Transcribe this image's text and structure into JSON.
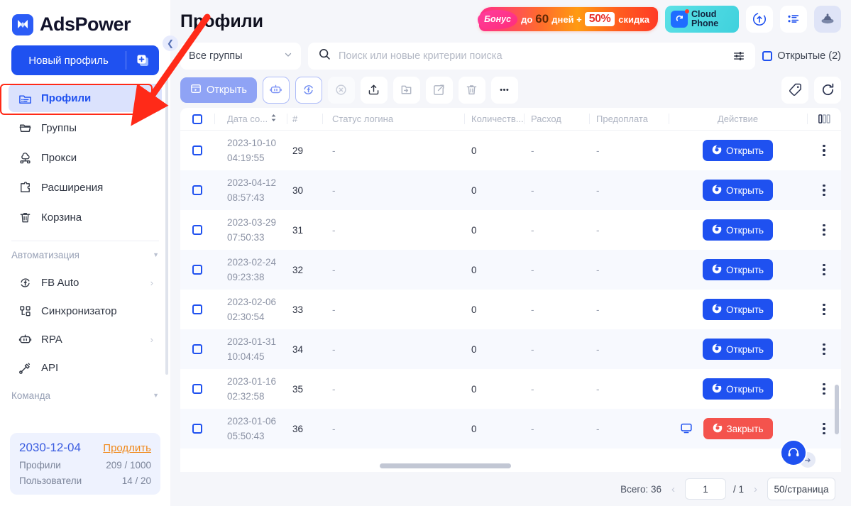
{
  "brand": {
    "name": "AdsPower"
  },
  "sidebar": {
    "new_profile_label": "Новый профиль",
    "items": [
      {
        "label": "Профили",
        "icon": "profiles-icon",
        "active": true
      },
      {
        "label": "Группы",
        "icon": "groups-icon",
        "active": false
      },
      {
        "label": "Прокси",
        "icon": "proxy-icon",
        "active": false
      },
      {
        "label": "Расширения",
        "icon": "extensions-icon",
        "active": false
      },
      {
        "label": "Корзина",
        "icon": "trash-icon",
        "active": false
      }
    ],
    "automation_group": "Автоматизация",
    "automation_items": [
      {
        "label": "FB Auto",
        "icon": "facebook-auto-icon",
        "chevron": "›"
      },
      {
        "label": "Синхронизатор",
        "icon": "synchronizer-icon",
        "chevron": ""
      },
      {
        "label": "RPA",
        "icon": "rpa-robot-icon",
        "chevron": "›"
      },
      {
        "label": "API",
        "icon": "api-icon",
        "chevron": ""
      }
    ],
    "team_group": "Команда",
    "plan": {
      "date": "2030-12-04",
      "renew_label": "Продлить",
      "profiles_label": "Профили",
      "profiles_value": "209 / 1000",
      "users_label": "Пользователи",
      "users_value": "14 / 20"
    }
  },
  "header": {
    "title": "Профили",
    "promo": {
      "bonus": "Бонус",
      "text1": "до",
      "days": "60",
      "text2": "дней +",
      "percent": "50%",
      "text3": "скидка"
    },
    "cloud_phone": {
      "line1": "Cloud",
      "line2": "Phone"
    },
    "icons": [
      {
        "name": "sync-update-icon"
      },
      {
        "name": "task-list-icon"
      },
      {
        "name": "avatar-icon"
      }
    ]
  },
  "search": {
    "group_select_value": "Все группы",
    "placeholder": "Поиск или новые критерии поиска",
    "value": "",
    "filter_icon": "filter-sliders-icon",
    "opened_label": "Открытые (2)"
  },
  "toolbar": {
    "open_label": "Открыть",
    "buttons": [
      {
        "name": "rpa-robot-button",
        "style": "outlined"
      },
      {
        "name": "facebook-sync-button",
        "style": "outlined"
      },
      {
        "name": "close-all-button",
        "style": "muted"
      },
      {
        "name": "upload-button",
        "style": "plain"
      },
      {
        "name": "import-button",
        "style": "plain"
      },
      {
        "name": "export-share-button",
        "style": "plain"
      },
      {
        "name": "delete-button",
        "style": "plain"
      },
      {
        "name": "more-button",
        "style": "plain"
      }
    ],
    "right_buttons": [
      {
        "name": "tag-button"
      },
      {
        "name": "refresh-button"
      }
    ]
  },
  "table": {
    "columns": [
      {
        "key": "date",
        "label": "Дата со...",
        "sortable": true
      },
      {
        "key": "num",
        "label": "#"
      },
      {
        "key": "status",
        "label": "Статус логина"
      },
      {
        "key": "qty",
        "label": "Количеств..."
      },
      {
        "key": "spend",
        "label": "Расход"
      },
      {
        "key": "prepay",
        "label": "Предоплата"
      },
      {
        "key": "action",
        "label": "Действие"
      }
    ],
    "rows": [
      {
        "date": "2023-10-10",
        "time": "04:19:55",
        "num": "29",
        "status": "-",
        "qty": "0",
        "spend": "-",
        "prepay": "-",
        "action_label": "Открыть",
        "action_state": "open"
      },
      {
        "date": "2023-04-12",
        "time": "08:57:43",
        "num": "30",
        "status": "-",
        "qty": "0",
        "spend": "-",
        "prepay": "-",
        "action_label": "Открыть",
        "action_state": "open"
      },
      {
        "date": "2023-03-29",
        "time": "07:50:33",
        "num": "31",
        "status": "-",
        "qty": "0",
        "spend": "-",
        "prepay": "-",
        "action_label": "Открыть",
        "action_state": "open"
      },
      {
        "date": "2023-02-24",
        "time": "09:23:38",
        "num": "32",
        "status": "-",
        "qty": "0",
        "spend": "-",
        "prepay": "-",
        "action_label": "Открыть",
        "action_state": "open"
      },
      {
        "date": "2023-02-06",
        "time": "02:30:54",
        "num": "33",
        "status": "-",
        "qty": "0",
        "spend": "-",
        "prepay": "-",
        "action_label": "Открыть",
        "action_state": "open"
      },
      {
        "date": "2023-01-31",
        "time": "10:04:45",
        "num": "34",
        "status": "-",
        "qty": "0",
        "spend": "-",
        "prepay": "-",
        "action_label": "Открыть",
        "action_state": "open"
      },
      {
        "date": "2023-01-16",
        "time": "02:32:58",
        "num": "35",
        "status": "-",
        "qty": "0",
        "spend": "-",
        "prepay": "-",
        "action_label": "Открыть",
        "action_state": "open"
      },
      {
        "date": "2023-01-06",
        "time": "05:50:43",
        "num": "36",
        "status": "-",
        "qty": "0",
        "spend": "-",
        "prepay": "-",
        "action_label": "Закрыть",
        "action_state": "close"
      }
    ]
  },
  "footer": {
    "total": "Всего: 36",
    "page_value": "1",
    "page_of": "/ 1",
    "page_size": "50/страница",
    "prev": "‹",
    "next": "›"
  },
  "colors": {
    "brand_blue": "#1f51f0",
    "danger_red": "#f4534d",
    "annotation_red": "#ff2a18",
    "accent_orange": "#f0891a"
  }
}
